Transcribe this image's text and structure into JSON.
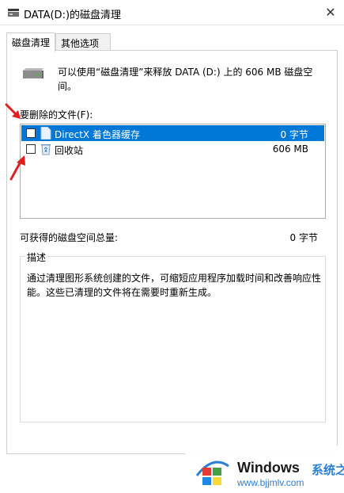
{
  "window": {
    "title": "DATA(D:)的磁盘清理",
    "close_glyph": "✕"
  },
  "tabs": [
    {
      "label": "磁盘清理"
    },
    {
      "label": "其他选项"
    }
  ],
  "info": {
    "text": "可以使用“磁盘清理”来释放 DATA (D:) 上的 606 MB 磁盘空间。"
  },
  "files_section": {
    "label": "要删除的文件(F):",
    "items": [
      {
        "name": "DirectX 着色器缓存",
        "size": "0 字节",
        "checked": false,
        "selected": true,
        "icon": "file-icon"
      },
      {
        "name": "回收站",
        "size": "606 MB",
        "checked": false,
        "selected": false,
        "icon": "recycle-bin-icon"
      }
    ]
  },
  "total": {
    "label": "可获得的磁盘空间总量:",
    "value": "0 字节"
  },
  "description": {
    "title": "描述",
    "text": "通过清理图形系统创建的文件，可缩短应用程序加载时间和改善响应性能。这些已清理的文件将在需要时重新生成。"
  },
  "watermark": {
    "brand": "Windows",
    "brand_cn": "系统之家",
    "url": "www.bjjmlv.com"
  },
  "colors": {
    "selection": "#0078d7",
    "arrow": "#e02020"
  }
}
